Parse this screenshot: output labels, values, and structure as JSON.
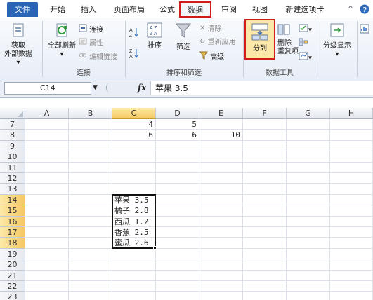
{
  "tabs": [
    {
      "label": "文件",
      "kind": "file"
    },
    {
      "label": "开始"
    },
    {
      "label": "插入"
    },
    {
      "label": "页面布局"
    },
    {
      "label": "公式"
    },
    {
      "label": "数据",
      "kind": "active"
    },
    {
      "label": "审阅"
    },
    {
      "label": "视图"
    },
    {
      "label": "新建选项卡"
    }
  ],
  "ribbon": {
    "get_external_line1": "获取",
    "get_external_line2": "外部数据",
    "refresh_all": "全部刷新",
    "connections": "连接",
    "properties": "属性",
    "edit_links": "编辑链接",
    "group_connections": "连接",
    "sort_asc": "A↓Z",
    "sort": "排序",
    "filter": "筛选",
    "clear": "清除",
    "reapply": "重新应用",
    "advanced": "高级",
    "group_sort_filter": "排序和筛选",
    "text_to_columns": "分列",
    "remove_duplicates_line1": "删除",
    "remove_duplicates_line2": "重复项",
    "group_data_tools": "数据工具",
    "outline": "分级显示"
  },
  "formula_bar": {
    "name_box": "C14",
    "fx": "fx",
    "formula": "苹果 3.5"
  },
  "columns": [
    "A",
    "B",
    "C",
    "D",
    "E",
    "F",
    "G",
    "H"
  ],
  "selected_column": "C",
  "rows": [
    {
      "num": "7",
      "cells": {
        "C": "4",
        "D": "5"
      }
    },
    {
      "num": "8",
      "cells": {
        "C": "6",
        "D": "6",
        "E": "10"
      }
    },
    {
      "num": "9",
      "cells": {}
    },
    {
      "num": "10",
      "cells": {}
    },
    {
      "num": "11",
      "cells": {}
    },
    {
      "num": "12",
      "cells": {}
    },
    {
      "num": "13",
      "cells": {}
    },
    {
      "num": "14",
      "cells": {
        "C": "苹果 3.5"
      },
      "selected": true
    },
    {
      "num": "15",
      "cells": {
        "C": "橘子 2.8"
      },
      "selected": true
    },
    {
      "num": "16",
      "cells": {
        "C": "西瓜 1.2"
      },
      "selected": true
    },
    {
      "num": "17",
      "cells": {
        "C": "香蕉 2.5"
      },
      "selected": true
    },
    {
      "num": "18",
      "cells": {
        "C": "蜜瓜 2.6"
      },
      "selected": true
    },
    {
      "num": "19",
      "cells": {}
    },
    {
      "num": "20",
      "cells": {}
    },
    {
      "num": "21",
      "cells": {}
    },
    {
      "num": "22",
      "cells": {}
    },
    {
      "num": "23",
      "cells": {}
    }
  ],
  "colors": {
    "file_tab": "#2a64b4",
    "highlight_red": "#d11a1a",
    "selected_header": "#f5c862"
  }
}
